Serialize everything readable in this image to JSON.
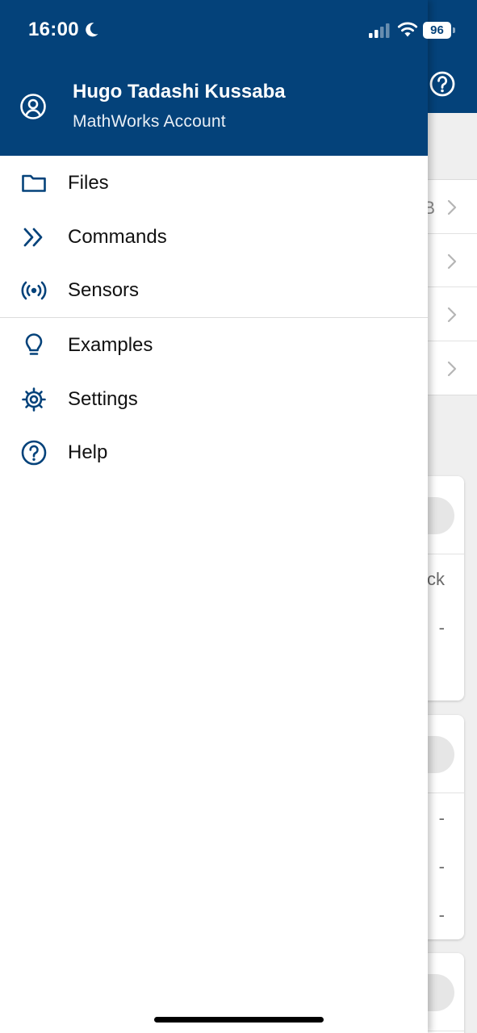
{
  "status_bar": {
    "time": "16:00",
    "battery": "96"
  },
  "drawer": {
    "account": {
      "name": "Hugo Tadashi Kussaba",
      "subtitle": "MathWorks Account"
    },
    "primary_items": [
      {
        "label": "Files",
        "icon": "folder-icon"
      },
      {
        "label": "Commands",
        "icon": "double-chevron-right-icon"
      },
      {
        "label": "Sensors",
        "icon": "broadcast-icon"
      }
    ],
    "secondary_items": [
      {
        "label": "Examples",
        "icon": "lightbulb-icon"
      },
      {
        "label": "Settings",
        "icon": "gear-icon"
      },
      {
        "label": "Help",
        "icon": "help-circle-icon"
      }
    ]
  },
  "background": {
    "list_values": [
      "B",
      "",
      "",
      ""
    ],
    "card1_text": [
      "ck",
      "-"
    ],
    "card2_text": [
      "-",
      "-",
      "-"
    ]
  },
  "colors": {
    "brand": "#04427a",
    "drawer_bg": "#ffffff",
    "text": "#111111",
    "divider": "#dcdcdc"
  }
}
